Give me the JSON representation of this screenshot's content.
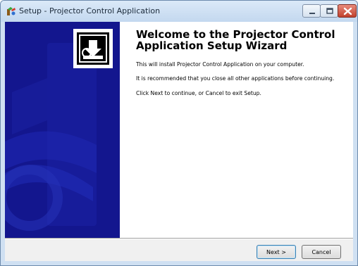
{
  "window": {
    "title": "Setup - Projector Control Application"
  },
  "welcome": {
    "heading": "Welcome to the Projector Control Application Setup Wizard",
    "paragraphs": [
      "This will install Projector Control Application on your computer.",
      "It is recommended that you close all other applications before continuing.",
      "Click Next to continue, or Cancel to exit Setup."
    ]
  },
  "buttons": {
    "next": "Next >",
    "cancel": "Cancel"
  },
  "icons": {
    "app": "setup-app-icon",
    "logo": "projector-install-icon",
    "minimize": "minimize-icon",
    "maximize": "maximize-icon",
    "close": "close-icon"
  },
  "colors": {
    "sidebar": "#13168e",
    "close_button": "#c1422e"
  }
}
